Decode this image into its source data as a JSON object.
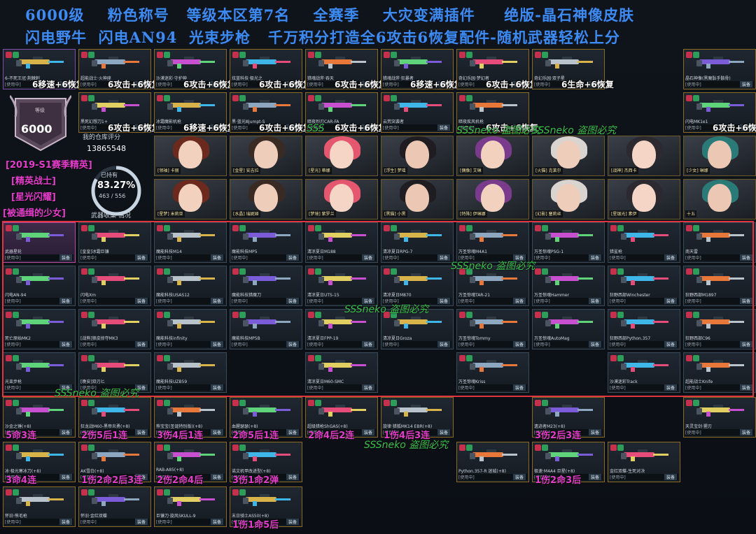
{
  "header": {
    "line1": "6000级    粉色称号   等级本区第7名    全赛季    大灾变满插件     绝版-晶石神像皮肤",
    "line2": "闪电野牛  闪电AN94  光束步枪   千万积分打造全6攻击6恢复配件-随机武器轻松上分"
  },
  "profile": {
    "level_label": "等级",
    "level_value": "6000",
    "ranks": [
      "[2019-S1赛季精英]",
      "[精英战士]",
      "[星光闪耀]",
      "[被通缉的少女]"
    ],
    "score_label": "我的仓库评分",
    "score_value": "13865548",
    "owned_label": "已持有",
    "owned_percent": "83.27%",
    "owned_fraction": "463 / 556",
    "owned_ratio": 0.8327,
    "collection_label": "武器收集 情况"
  },
  "watermark": "SSSneko 盗图必究",
  "watermark_short": "SSS",
  "cards": [
    {
      "id": "r1c1",
      "caption": "6-不死王冠·荆棘刺",
      "overlay": "6移速+6恢复"
    },
    {
      "id": "r1c2",
      "caption": "超能战士·火神座",
      "overlay": "6攻击+6恢复"
    },
    {
      "id": "r1c3",
      "caption": "沙漠迷彩·守护神",
      "overlay": "6攻击+6恢复"
    },
    {
      "id": "r1c4",
      "caption": "炫蓝科技·极光之",
      "overlay": "6攻击+6恢复"
    },
    {
      "id": "r1c5",
      "caption": "猎魂战斧·吞天",
      "overlay": "6攻击+6恢复"
    },
    {
      "id": "r1c6",
      "caption": "猎魂战斧·狂暴者",
      "overlay": "6移速+6恢复"
    },
    {
      "id": "r1c7",
      "caption": "奇幻乐园·梦幻者",
      "overlay": "6攻击+6恢复"
    },
    {
      "id": "r1c8",
      "caption": "奇幻乐园·双子星",
      "overlay": "6生命+6恢复"
    },
    {
      "id": "r1c10",
      "caption": "晶石神像(黑魔骷手骸骨)",
      "overlay": ""
    },
    {
      "id": "r2c2",
      "caption": "黑死幻想刀1+",
      "overlay": "6攻击+6恢复"
    },
    {
      "id": "r2c3",
      "caption": "冰霜魔影机枪",
      "overlay": "6移速+6恢复"
    },
    {
      "id": "r2c4",
      "caption": "黑·蓝光Ⅲjumpt-S",
      "overlay": "6攻击+6恢复"
    },
    {
      "id": "r2c5",
      "caption": "暗夜烈刃CAR-FA",
      "overlay": "6攻击+6恢复"
    },
    {
      "id": "r2c6",
      "caption": "云荒突袭者",
      "overlay": ""
    },
    {
      "id": "r2c7",
      "caption": "暗夜疾风机枪",
      "overlay": "6攻击+6恢复"
    },
    {
      "id": "r2c10",
      "caption": "闪电MK1e1",
      "overlay": "6攻击+6恢复"
    }
  ],
  "characters": [
    {
      "caption": "[领袖] 卡丽"
    },
    {
      "caption": "[金星] 安吉拉"
    },
    {
      "caption": "[星光] 蒂娜"
    },
    {
      "caption": "[浮生] 梦瑶"
    },
    {
      "caption": "[偶像] 艾琳"
    },
    {
      "caption": "[火猫] 克莱尔"
    },
    {
      "caption": "[战神] 杰西卡"
    },
    {
      "caption": "[少女] 琳娜"
    },
    {
      "caption": "[星梦] 米莉亚"
    },
    {
      "caption": "[水晶] 瑞妮娅"
    },
    {
      "caption": "[梦境] 紫罗兰"
    },
    {
      "caption": "[黑猫] 小黑"
    },
    {
      "caption": "[特殊] 伊琳娜"
    },
    {
      "caption": "[幻影] 塞莉丝"
    },
    {
      "caption": "[星银光] 素伊"
    },
    {
      "caption": "十五"
    }
  ],
  "grid": [
    {
      "caption": "武器星轮"
    },
    {
      "caption": "[皇皇]冰霜巨镰"
    },
    {
      "caption": "魔能科技M14"
    },
    {
      "caption": "魔能科技MP5"
    },
    {
      "caption": "清凉夏日M188"
    },
    {
      "caption": "清凉夏日RPG-7"
    },
    {
      "caption": "万圣惊魂M4A1"
    },
    {
      "caption": "万圣惊魂PSG-1"
    },
    {
      "caption": "猎鲨枪"
    },
    {
      "caption": "南天雷"
    },
    {
      "caption": "闪电AN-94"
    },
    {
      "caption": "闪电Xm"
    },
    {
      "caption": "魔能科技USAS12"
    },
    {
      "caption": "魔能科技猎魔刀"
    },
    {
      "caption": "清凉夏日UTS-15"
    },
    {
      "caption": "清凉夏日M870"
    },
    {
      "caption": "万圣惊魂TAR-21"
    },
    {
      "caption": "万圣惊魂Hammer"
    },
    {
      "caption": "狂野西部Winchester"
    },
    {
      "caption": "狂野西部M1897"
    },
    {
      "caption": "死亡原始MK2"
    },
    {
      "caption": "[战熊]狼皮掠夺MK3"
    },
    {
      "caption": "魔能科技infinity"
    },
    {
      "caption": "魔能科技MP5B"
    },
    {
      "caption": "清凉夏日FPP-19"
    },
    {
      "caption": "清凉夏日Groza"
    },
    {
      "caption": "万圣惊魂Tommy"
    },
    {
      "caption": "万圣惊魂AutoMag"
    },
    {
      "caption": "狂野西部Python.357"
    },
    {
      "caption": "狂野西部C96"
    },
    {
      "caption": "光束步枪"
    },
    {
      "caption": "[晚安]双刃匕"
    },
    {
      "caption": "魔能科技UZB59"
    },
    {
      "caption": ""
    },
    {
      "caption": "清凉夏日M60-SMC"
    },
    {
      "caption": ""
    },
    {
      "caption": "万圣惊魂Kriss"
    },
    {
      "caption": ""
    },
    {
      "caption": "沙漠迷彩Track"
    },
    {
      "caption": "超能战士Knife"
    }
  ],
  "bottom": [
    {
      "caption": "沙金之锤(+8)",
      "overlay": "5命3连"
    },
    {
      "caption": "狂龙战M60-黑帝炎勇(+8)",
      "overlay": "2伤5后1连"
    },
    {
      "caption": "熊宝宝(圣诞特别版)(+8)",
      "overlay": "3伤4后1连"
    },
    {
      "caption": "血腥瑟瑟(+8)",
      "overlay": "2命5后1连"
    },
    {
      "caption": "超级猎枪ShGAS(+8)",
      "overlay": "2命4后2连"
    },
    {
      "caption": "旋律·猎狐MK14 EBR(+8)",
      "overlay": "1伤4后3连"
    },
    {
      "caption": "遗迹者M23(+8)",
      "overlay": "3伤2后3连"
    },
    {
      "caption": "天灵宝剑·猩刃",
      "overlay": ""
    },
    {
      "caption": "冰·极光寒冰刀(+8)",
      "overlay": "3命4连"
    },
    {
      "caption": "AK雪白(+8)",
      "overlay": "1伤2命2后3连"
    },
    {
      "caption": "RAB-A85(+8)",
      "overlay": "2伤2命4后"
    },
    {
      "caption": "诺文机甲改进型(+8)",
      "overlay": "3伤1命2弹"
    },
    {
      "caption": "Python.357-R 迷城(+8)",
      "overlay": ""
    },
    {
      "caption": "极速·M4A4 巨星(+8)",
      "overlay": "1伤2命3后"
    },
    {
      "caption": "金红双蝶-生死对决",
      "overlay": ""
    },
    {
      "caption": "怀旧·熊毛枪",
      "overlay": ""
    },
    {
      "caption": "怀旧·金红双蝶",
      "overlay": ""
    },
    {
      "caption": "巨镰刀·旋风SKULL-9",
      "overlay": ""
    },
    {
      "caption": "末日骑士AS50(+8)",
      "overlay": "1伤1命5后"
    }
  ],
  "labels": {
    "equip": "装备",
    "in_use": "[使用中]"
  },
  "colors": {
    "accent_blue": "#3d8bf0",
    "overlay_pink": "#e43dcb",
    "watermark_green": "#39c14b",
    "selection_red": "#e0343e"
  }
}
